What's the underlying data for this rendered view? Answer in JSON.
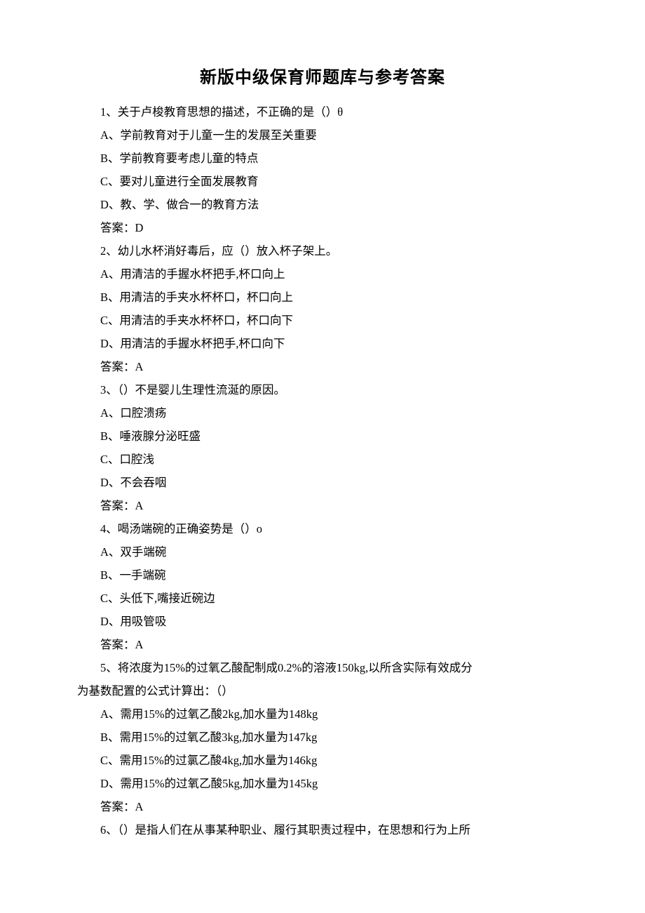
{
  "title": "新版中级保育师题库与参考答案",
  "lines": [
    {
      "text": "1、关于卢梭教育思想的描述，不正确的是（）θ",
      "indent": true
    },
    {
      "text": "A、学前教育对于儿童一生的发展至关重要",
      "indent": true
    },
    {
      "text": "B、学前教育要考虑儿童的特点",
      "indent": true
    },
    {
      "text": "C、要对儿童进行全面发展教育",
      "indent": true
    },
    {
      "text": "D、教、学、做合一的教育方法",
      "indent": true
    },
    {
      "text": "答案：D",
      "indent": true
    },
    {
      "text": "2、幼儿水杯消好毒后，应（）放入杯子架上。",
      "indent": true
    },
    {
      "text": "A、用清洁的手握水杯把手,杯口向上",
      "indent": true
    },
    {
      "text": "B、用清洁的手夹水杯杯口，杯口向上",
      "indent": true
    },
    {
      "text": "C、用清洁的手夹水杯杯口，杯口向下",
      "indent": true
    },
    {
      "text": "D、用清洁的手握水杯把手,杯口向下",
      "indent": true
    },
    {
      "text": "答案：A",
      "indent": true
    },
    {
      "text": "3、（）不是婴儿生理性流涎的原因。",
      "indent": true
    },
    {
      "text": "A、口腔溃疡",
      "indent": true
    },
    {
      "text": "B、唾液腺分泌旺盛",
      "indent": true
    },
    {
      "text": "C、口腔浅",
      "indent": true
    },
    {
      "text": "D、不会吞咽",
      "indent": true
    },
    {
      "text": "答案：A",
      "indent": true
    },
    {
      "text": "4、喝汤端碗的正确姿势是（）o",
      "indent": true
    },
    {
      "text": "A、双手端碗",
      "indent": true
    },
    {
      "text": "B、一手端碗",
      "indent": true
    },
    {
      "text": "C、头低下,嘴接近碗边",
      "indent": true
    },
    {
      "text": "D、用吸管吸",
      "indent": true
    },
    {
      "text": "答案：A",
      "indent": true
    },
    {
      "text": "5、将浓度为15%的过氧乙酸配制成0.2%的溶液150kg,以所含实际有效成分",
      "indent": true
    },
    {
      "text": "为基数配置的公式计算出：（）",
      "indent": false
    },
    {
      "text": "A、需用15%的过氧乙酸2kg,加水量为148kg",
      "indent": true
    },
    {
      "text": "B、需用15%的过氧乙酸3kg,加水量为147kg",
      "indent": true
    },
    {
      "text": "C、需用15%的过氯乙酸4kg,加水量为146kg",
      "indent": true
    },
    {
      "text": "D、需用15%的过氧乙酸5kg,加水量为145kg",
      "indent": true
    },
    {
      "text": "答案：A",
      "indent": true
    },
    {
      "text": "6、（）是指人们在从事某种职业、履行其职责过程中，在思想和行为上所",
      "indent": true
    }
  ]
}
